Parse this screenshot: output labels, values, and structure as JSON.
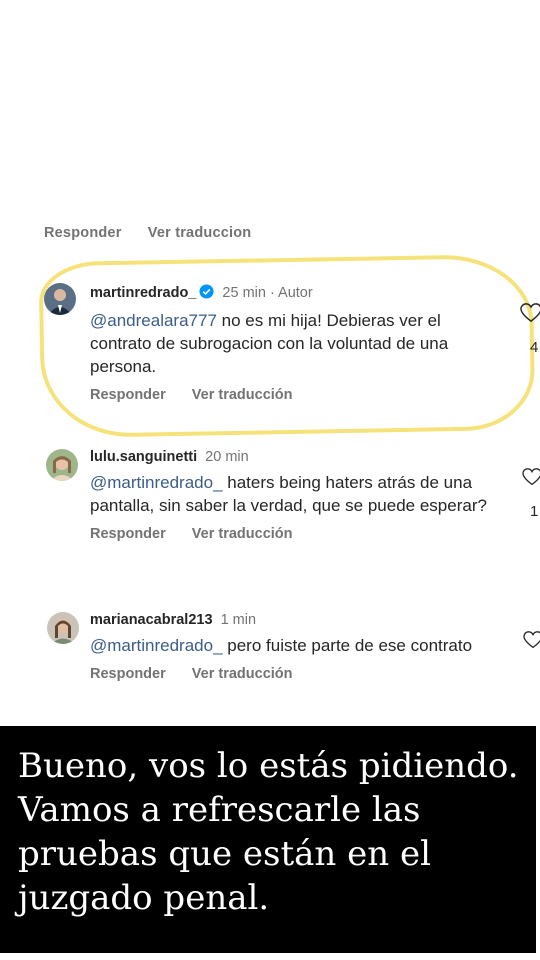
{
  "top_actions": {
    "reply": "Responder",
    "translate": "Ver traduccion"
  },
  "comments": [
    {
      "username": "martinredrado_",
      "verified": true,
      "time": "25 min",
      "separator": "·",
      "author_badge": "Autor",
      "mention": "@andrealara777",
      "text": " no es mi hija! Debieras ver el contrato de subrogacion con la voluntad de una persona.",
      "reply": "Responder",
      "translate": "Ver traducción",
      "likes": "4"
    },
    {
      "username": "lulu.sanguinetti",
      "time": "20 min",
      "mention": "@martinredrado_",
      "text": " haters being haters atrás de una pantalla, sin saber la verdad, que se puede esperar?",
      "reply": "Responder",
      "translate": "Ver traducción",
      "likes": "1"
    },
    {
      "username": "marianacabral213",
      "time": "1 min",
      "mention": "@martinredrado_",
      "text": " pero fuiste parte de ese contrato",
      "reply": "Responder",
      "translate": "Ver traducción",
      "likes": ""
    }
  ],
  "overlay": {
    "text": "Bueno, vos lo estás pidiendo. Vamos a refrescarle las pruebas que están en el juzgado penal."
  },
  "colors": {
    "highlight": "#f6e27a",
    "verified": "#0095f6",
    "overlay_bg": "#000000"
  }
}
